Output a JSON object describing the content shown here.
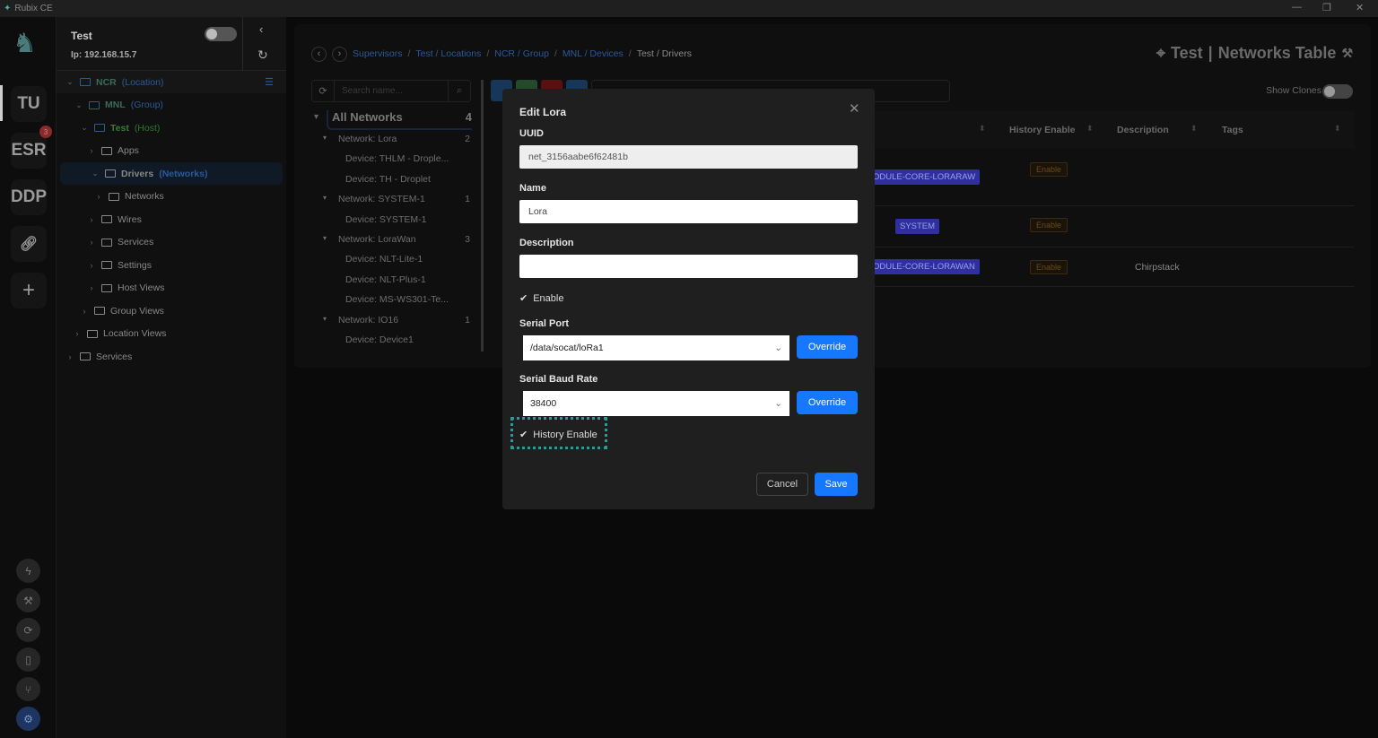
{
  "window": {
    "title": "Rubix CE",
    "controls": [
      "—",
      "❐",
      "✕"
    ]
  },
  "rail": {
    "items": [
      {
        "label": "TU"
      },
      {
        "label": "ESR",
        "badge": "3"
      },
      {
        "label": "DDP"
      }
    ],
    "bottom_icons": [
      "bolt-icon",
      "wrench-icon",
      "sync-icon",
      "book-icon",
      "branch-icon",
      "gear-icon"
    ]
  },
  "host": {
    "name": "Test",
    "ip": "Ip: 192.168.15.7",
    "toggle_on": false
  },
  "tree": [
    {
      "label": "NCR",
      "tag": "(Location)",
      "level": 0
    },
    {
      "label": "MNL",
      "tag": "(Group)",
      "level": 1
    },
    {
      "label": "Test",
      "tag": "(Host)",
      "level": 2
    },
    {
      "label": "Apps",
      "level": 3
    },
    {
      "label": "Drivers",
      "tag": "(Networks)",
      "level": 3
    },
    {
      "label": "Networks",
      "level": 4
    },
    {
      "label": "Wires",
      "level": 3
    },
    {
      "label": "Services",
      "level": 3
    },
    {
      "label": "Settings",
      "level": 3
    },
    {
      "label": "Host Views",
      "level": 3
    },
    {
      "label": "Group Views",
      "level": 2
    },
    {
      "label": "Location Views",
      "level": 1
    },
    {
      "label": "Services",
      "level": 0
    }
  ],
  "breadcrumb": [
    "Supervisors",
    "Test / Locations",
    "NCR / Group",
    "MNL / Devices",
    "Test / Drivers"
  ],
  "page_title": {
    "host": "Test",
    "title": "Networks Table"
  },
  "search": {
    "placeholder": "Search name..."
  },
  "show_clones": {
    "label": "Show Clones",
    "on": false
  },
  "networks_tree": {
    "root": "All Networks",
    "count": "4",
    "items": [
      {
        "label": "Network: Lora",
        "count": "2",
        "type": "network"
      },
      {
        "label": "Device: THLM - Drople...",
        "type": "device"
      },
      {
        "label": "Device: TH - Droplet",
        "type": "device"
      },
      {
        "label": "Network: SYSTEM-1",
        "count": "1",
        "type": "network"
      },
      {
        "label": "Device: SYSTEM-1",
        "type": "device"
      },
      {
        "label": "Network: LoraWan",
        "count": "3",
        "type": "network"
      },
      {
        "label": "Device: NLT-Lite-1",
        "type": "device"
      },
      {
        "label": "Device: NLT-Plus-1",
        "type": "device"
      },
      {
        "label": "Device: MS-WS301-Te...",
        "type": "device"
      },
      {
        "label": "Network: IO16",
        "count": "1",
        "type": "network"
      },
      {
        "label": "Device: Device1",
        "type": "device"
      }
    ]
  },
  "table": {
    "headers": [
      "History Enable",
      "Description",
      "Tags"
    ],
    "rows": [
      {
        "plugin": "ODULE-CORE-LORARAW",
        "history": "Enable",
        "description": ""
      },
      {
        "plugin": "SYSTEM",
        "history": "Enable",
        "description": ""
      },
      {
        "plugin": "ODULE-CORE-LORAWAN",
        "history": "Enable",
        "description": "Chirpstack"
      }
    ]
  },
  "modal": {
    "title": "Edit Lora",
    "uuid_label": "UUID",
    "uuid": "net_3156aabe6f62481b",
    "name_label": "Name",
    "name": "Lora",
    "description_label": "Description",
    "description": "",
    "enable_label": "Enable",
    "enable": true,
    "serial_port_label": "Serial Port",
    "serial_port": "/data/socat/loRa1",
    "baud_label": "Serial Baud Rate",
    "baud": "38400",
    "override": "Override",
    "history_label": "History Enable",
    "history": true,
    "cancel": "Cancel",
    "save": "Save"
  },
  "colors": {
    "accent": "#1677ff",
    "tag": "#2f2fa0"
  }
}
